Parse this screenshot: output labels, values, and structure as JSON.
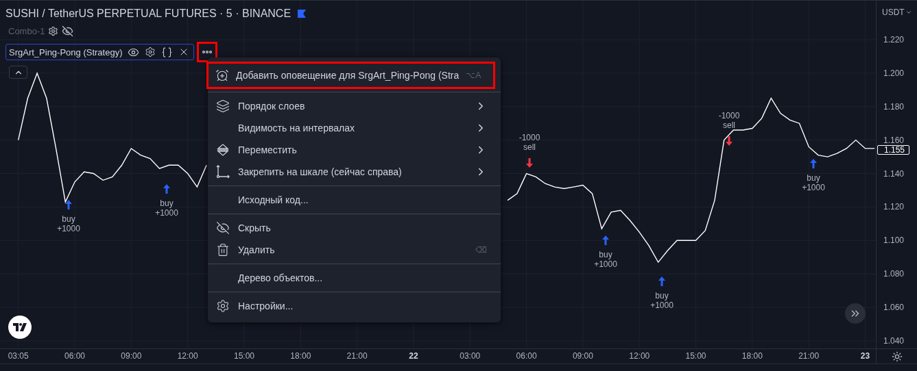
{
  "header": {
    "title": "SUSHI / TetherUS PERPETUAL FUTURES · 5 · BINANCE"
  },
  "indicators": [
    {
      "name": "Combo-1",
      "hidden": true
    }
  ],
  "strategy": {
    "name": "SrgArt_Ping-Pong (Strategy)",
    "selected": true,
    "more_highlighted": true
  },
  "price_axis": {
    "currency": "USDT",
    "last_price": "1.155"
  },
  "chart": {
    "chart_data": {
      "type": "line",
      "grid": true,
      "ylim": [
        1.0355,
        1.2433
      ],
      "yticks": [
        {
          "value": 1.04,
          "label": "1.040"
        },
        {
          "value": 1.06,
          "label": "1.060"
        },
        {
          "value": 1.08,
          "label": "1.080"
        },
        {
          "value": 1.1,
          "label": "1.100"
        },
        {
          "value": 1.12,
          "label": "1.120"
        },
        {
          "value": 1.14,
          "label": "1.140"
        },
        {
          "value": 1.16,
          "label": "1.160"
        },
        {
          "value": 1.18,
          "label": "1.180"
        },
        {
          "value": 1.2,
          "label": "1.200"
        },
        {
          "value": 1.22,
          "label": "1.220"
        }
      ],
      "categories": [
        "03:05",
        null,
        null,
        null,
        null,
        null,
        "06:00",
        null,
        null,
        null,
        null,
        null,
        "09:00",
        null,
        null,
        null,
        null,
        null,
        "12:00",
        null,
        null,
        null,
        null,
        null,
        "15:00",
        null,
        null,
        null,
        null,
        null,
        "18:00",
        null,
        null,
        null,
        null,
        null,
        "21:00",
        null,
        null,
        null,
        null,
        null,
        "22",
        null,
        null,
        null,
        null,
        null,
        "03:00",
        null,
        null,
        null,
        null,
        null,
        "06:00",
        null,
        null,
        null,
        null,
        null,
        "09:00",
        null,
        null,
        null,
        null,
        null,
        "12:00",
        null,
        null,
        null,
        null,
        null,
        "15:00",
        null,
        null,
        null,
        null,
        null,
        "18:00",
        null,
        null,
        null,
        null,
        null,
        "21:00",
        null,
        null,
        null,
        null,
        null,
        "23",
        null
      ],
      "values": [
        1.16,
        1.185,
        1.2,
        1.185,
        1.155,
        1.123,
        1.135,
        1.141,
        1.14,
        1.136,
        1.138,
        1.145,
        1.155,
        1.151,
        1.149,
        1.143,
        1.145,
        1.145,
        1.14,
        1.132,
        1.145,
        null,
        null,
        null,
        null,
        null,
        null,
        null,
        null,
        null,
        null,
        null,
        null,
        null,
        null,
        null,
        null,
        null,
        null,
        null,
        null,
        null,
        null,
        null,
        null,
        null,
        null,
        null,
        null,
        null,
        null,
        null,
        1.124,
        1.128,
        1.14,
        1.138,
        1.134,
        1.132,
        1.131,
        1.132,
        1.133,
        1.128,
        1.107,
        1.117,
        1.118,
        1.112,
        1.105,
        1.097,
        1.087,
        1.094,
        1.1,
        1.1,
        1.1,
        1.106,
        1.124,
        1.16,
        1.166,
        1.166,
        1.167,
        1.173,
        1.185,
        1.176,
        1.172,
        1.17,
        1.156,
        1.151,
        1.15,
        1.152,
        1.155,
        1.16,
        1.155,
        1.155
      ]
    },
    "tick_styles": [
      {
        "bold": false
      },
      {
        "bold": false
      },
      {
        "bold": false
      },
      {
        "bold": false
      },
      {
        "bold": false
      },
      {
        "bold": false
      },
      {
        "bold": false
      },
      {
        "bold": true
      },
      {
        "bold": false
      },
      {
        "bold": false
      },
      {
        "bold": false
      },
      {
        "bold": false
      },
      {
        "bold": false
      },
      {
        "bold": false
      },
      {
        "bold": false
      },
      {
        "bold": true
      }
    ],
    "signals": [
      {
        "kind": "buy",
        "label": "buy",
        "value": "+1000"
      },
      {
        "kind": "buy",
        "label": "buy",
        "value": "+1000"
      },
      {
        "kind": "sell",
        "label": "sell",
        "value": "-1000"
      },
      {
        "kind": "buy",
        "label": "buy",
        "value": "+1000"
      },
      {
        "kind": "buy",
        "label": "buy",
        "value": "+1000"
      },
      {
        "kind": "sell",
        "label": "sell",
        "value": "-1000"
      },
      {
        "kind": "buy",
        "label": "buy",
        "value": "+1000"
      }
    ]
  },
  "menu": {
    "groups": [
      {
        "items": [
          {
            "kind": "alarm",
            "label": "Добавить оповещение для SrgArt_Ping-Pong (Stra",
            "shortcut": "⌥A",
            "submenu": false,
            "highlighted": true
          }
        ]
      },
      {
        "items": [
          {
            "kind": "layers",
            "label": "Порядок слоев",
            "submenu": true,
            "highlighted": false
          },
          {
            "kind": "plain",
            "label": "Видимость на интервалах",
            "submenu": true,
            "highlighted": false
          },
          {
            "kind": "move",
            "label": "Переместить",
            "submenu": true,
            "highlighted": false
          },
          {
            "kind": "axis",
            "label": "Закрепить на шкале (сейчас справа)",
            "submenu": true,
            "highlighted": false
          }
        ]
      },
      {
        "items": [
          {
            "kind": "plain",
            "label": "Исходный код...",
            "submenu": false,
            "highlighted": false
          }
        ]
      },
      {
        "items": [
          {
            "kind": "hide",
            "label": "Скрыть",
            "submenu": false,
            "highlighted": false
          },
          {
            "kind": "trash",
            "label": "Удалить",
            "shortcut": "⌫",
            "submenu": false,
            "highlighted": false
          }
        ]
      },
      {
        "items": [
          {
            "kind": "plain",
            "label": "Дерево объектов...",
            "submenu": false,
            "highlighted": false
          }
        ]
      },
      {
        "items": [
          {
            "kind": "gear",
            "label": "Настройки...",
            "submenu": false,
            "highlighted": false
          }
        ]
      }
    ]
  }
}
